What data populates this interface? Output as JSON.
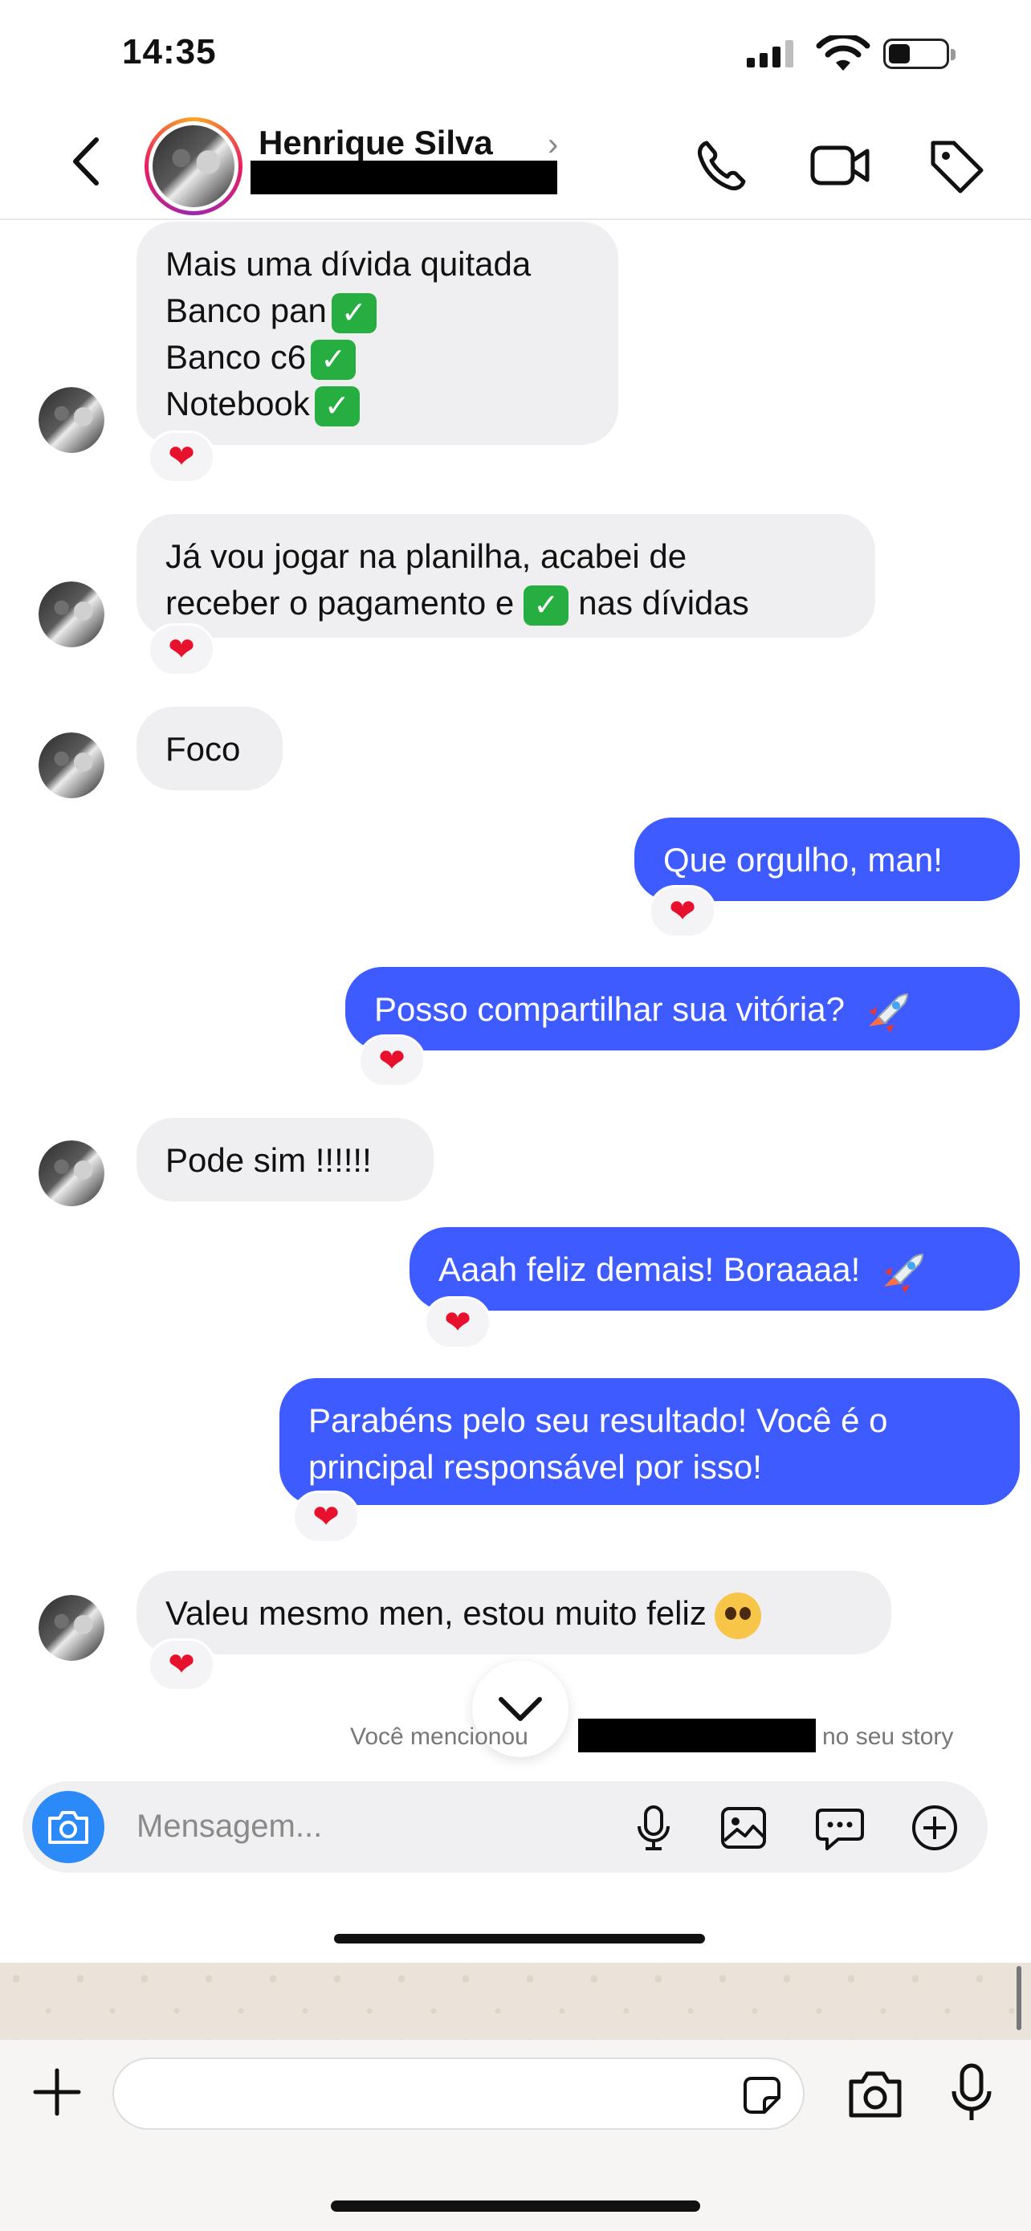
{
  "status_bar": {
    "time": "14:35"
  },
  "header": {
    "contact_name": "Henrique Silva",
    "chevron": "›"
  },
  "icons": {
    "back": "back-chevron-icon",
    "call": "phone-icon",
    "video": "video-camera-icon",
    "tag": "tag-icon",
    "reaction": "heart-icon"
  },
  "messages": [
    {
      "side": "in",
      "lines": [
        "Mais uma dívida quitada",
        "Banco pan",
        "Banco c6",
        "Notebook"
      ],
      "reaction": "❤"
    },
    {
      "side": "in",
      "line1": "Já vou jogar na planilha, acabei de",
      "line2a": "receber o pagamento e",
      "line2b": "nas dívidas",
      "reaction": "❤"
    },
    {
      "side": "in",
      "text": "Foco"
    },
    {
      "side": "out",
      "text": "Que orgulho, man!",
      "reaction": "❤"
    },
    {
      "side": "out",
      "text": "Posso compartilhar sua vitória?",
      "reaction": "❤"
    },
    {
      "side": "in",
      "text": "Pode sim !!!!!!"
    },
    {
      "side": "out",
      "text": "Aaah feliz demais! Boraaaa!",
      "reaction": "❤"
    },
    {
      "side": "out",
      "line1": "Parabéns pelo seu resultado! Você é o",
      "line2": "principal responsável por isso!",
      "reaction": "❤"
    },
    {
      "side": "in",
      "text": "Valeu mesmo men, estou muito feliz",
      "reaction": "❤"
    }
  ],
  "mention_note": {
    "prefix": "Você mencionou",
    "suffix": "no seu story"
  },
  "composer": {
    "placeholder": "Mensagem..."
  },
  "colors": {
    "outgoing_bubble": "#3d5bff",
    "incoming_bubble": "#efeff1",
    "camera_button": "#2b8af7",
    "heart": "#e8112d",
    "check": "#27ae40"
  }
}
